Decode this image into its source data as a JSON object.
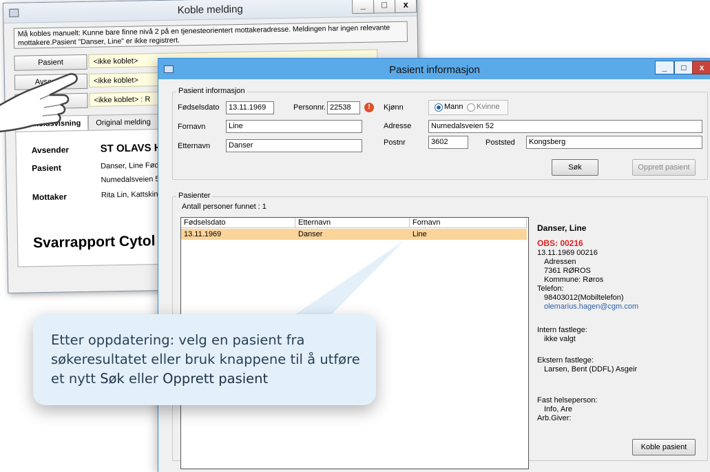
{
  "background_window": {
    "title": "Koble melding",
    "controls": {
      "minimize": "_",
      "maximize": "□",
      "close": "x"
    },
    "message": "Må kobles manuelt: Kunne bare finne nivå 2 på en tjenesteorientert mottakeradresse. Meldingen har ingen relevante mottakere.Pasient \"Danser, Line\" er ikke registrert.",
    "rows": [
      {
        "button": "Pasient",
        "value": "<ikke koblet>"
      },
      {
        "button": "Avsender",
        "value": "<ikke koblet>"
      },
      {
        "button": "Mottaker",
        "value": "<ikke koblet> : R"
      }
    ],
    "tabs": [
      "Innholdsvisning",
      "Original melding"
    ],
    "content": {
      "avsender_label": "Avsender",
      "avsender_value": "ST OLAVS H",
      "pasient_label": "Pasient",
      "pasient_value_1": "Danser, Line Fød",
      "pasient_value_2": "Numedalsveien 5",
      "mottaker_label": "Mottaker",
      "mottaker_value": "Rita Lin,  Kattskin",
      "heading": "Svarrapport Cytol"
    }
  },
  "dialog": {
    "title": "Pasient informasjon",
    "controls": {
      "minimize": "_",
      "maximize": "□",
      "close": "x"
    },
    "patient_group": {
      "label": "Pasient informasjon",
      "fodselsdato_label": "Fødselsdato",
      "fodselsdato_value": "13.11.1969",
      "personnr_label": "Personnr.",
      "personnr_value": "22538",
      "kjonn_label": "Kjønn",
      "gender_options": [
        "Mann",
        "Kvinne"
      ],
      "selected_gender": "Mann",
      "fornavn_label": "Fornavn",
      "fornavn_value": "Line",
      "adresse_label": "Adresse",
      "adresse_value": "Numedalsveien 52",
      "etternavn_label": "Etternavn",
      "etternavn_value": "Danser",
      "postnr_label": "Postnr",
      "postnr_value": "3602",
      "poststed_label": "Poststed",
      "poststed_value": "Kongsberg",
      "search_button": "Søk",
      "create_button": "Opprett pasient"
    },
    "results_group": {
      "label": "Pasienter",
      "count_text": "Antall personer funnet : 1",
      "columns": [
        "Fødselsdato",
        "Etternavn",
        "Fornavn"
      ],
      "rows": [
        {
          "fodselsdato": "13.11.1969",
          "etternavn": "Danser",
          "fornavn": "Line"
        }
      ]
    },
    "details": {
      "name": "Danser, Line",
      "obs": "OBS: 00216",
      "birth_id": "13.11.1969 00216",
      "address_line": "Adressen",
      "postal": "7361 RØROS",
      "kommune": "Kommune: Røros",
      "telefon_label": "Telefon:",
      "telefon_value": "98403012(Mobiltelefon)",
      "email": "olemarius.hagen@cgm.com",
      "intern_label": "Intern fastlege:",
      "intern_value": "ikke valgt",
      "ekstern_label": "Ekstern fastlege:",
      "ekstern_value": "Larsen, Bent (DDFL) Asgeir",
      "helseperson_label": "Fast helseperson:",
      "helseperson_value": "Info, Are",
      "arbgiver_label": "Arb.Giver:"
    },
    "link_button": "Koble pasient"
  },
  "callout": {
    "text_1": "Etter oppdatering: velg en pasient fra søkeresultatet eller bruk knappene til å utføre et nytt ",
    "bold_1": "Søk",
    "text_2": " eller ",
    "bold_2": "Opprett pasient"
  },
  "colors": {
    "title_bar": "#5aa9e8",
    "selected_row": "#fbd49a",
    "obs_red": "#e02020",
    "email_blue": "#2a5fa8",
    "callout_bg": "#e3f0fa"
  }
}
